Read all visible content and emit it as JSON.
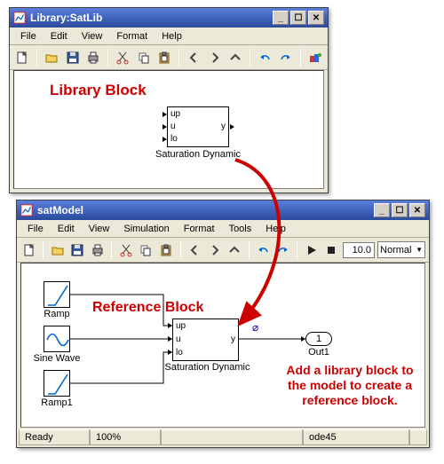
{
  "window1": {
    "title": "Library:SatLib",
    "menus": [
      "File",
      "Edit",
      "View",
      "Format",
      "Help"
    ],
    "annotation": "Library Block",
    "block": {
      "label": "Saturation Dynamic",
      "ports_in": [
        "up",
        "u",
        "lo"
      ],
      "port_out": "y"
    }
  },
  "window2": {
    "title": "satModel",
    "menus": [
      "File",
      "Edit",
      "View",
      "Simulation",
      "Format",
      "Tools",
      "Help"
    ],
    "stoptime": "10.0",
    "mode": "Normal",
    "annotation_block": "Reference Block",
    "annotation_text": "Add a library block to the model to create a reference block.",
    "src_blocks": [
      "Ramp",
      "Sine Wave",
      "Ramp1"
    ],
    "sat_block": {
      "label": "Saturation Dynamic",
      "ports_in": [
        "up",
        "u",
        "lo"
      ],
      "port_out": "y"
    },
    "out_block": {
      "num": "1",
      "label": "Out1"
    },
    "status": {
      "ready": "Ready",
      "zoom": "100%",
      "solver": "ode45"
    }
  }
}
